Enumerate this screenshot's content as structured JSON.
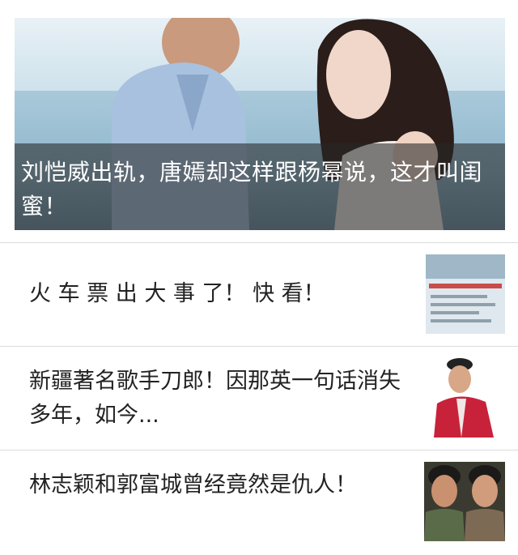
{
  "hero": {
    "title": "刘恺威出轨，唐嫣却这样跟杨幂说，这才叫闺蜜！"
  },
  "items": [
    {
      "title": "火 车 票 出 大 事 了！ 快 看！"
    },
    {
      "title": "新疆著名歌手刀郎！因那英一句话消失多年，如今..."
    },
    {
      "title": "林志颖和郭富城曾经竟然是仇人！"
    }
  ]
}
